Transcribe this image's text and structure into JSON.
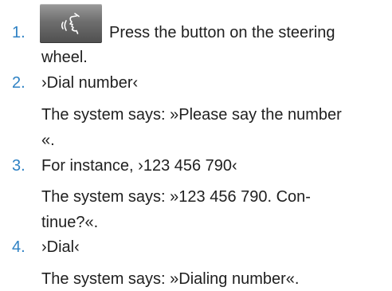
{
  "steps": [
    {
      "number": "1.",
      "lines": [
        "Press the button on the steering",
        "wheel."
      ],
      "icon": "voice-control-icon"
    },
    {
      "number": "2.",
      "lines": [
        "›Dial number‹"
      ],
      "response": [
        "The system says: »Please say the number",
        "«."
      ]
    },
    {
      "number": "3.",
      "lines": [
        "For instance, ›123 456 790‹"
      ],
      "response": [
        "The system says: »123 456 790. Con-",
        "tinue?«."
      ]
    },
    {
      "number": "4.",
      "lines": [
        "›Dial‹"
      ],
      "response": [
        "The system says: »Dialing number«."
      ]
    }
  ],
  "colors": {
    "step_number": "#2f82c4",
    "text": "#1f1f1f",
    "button": "#6e6e6e"
  }
}
